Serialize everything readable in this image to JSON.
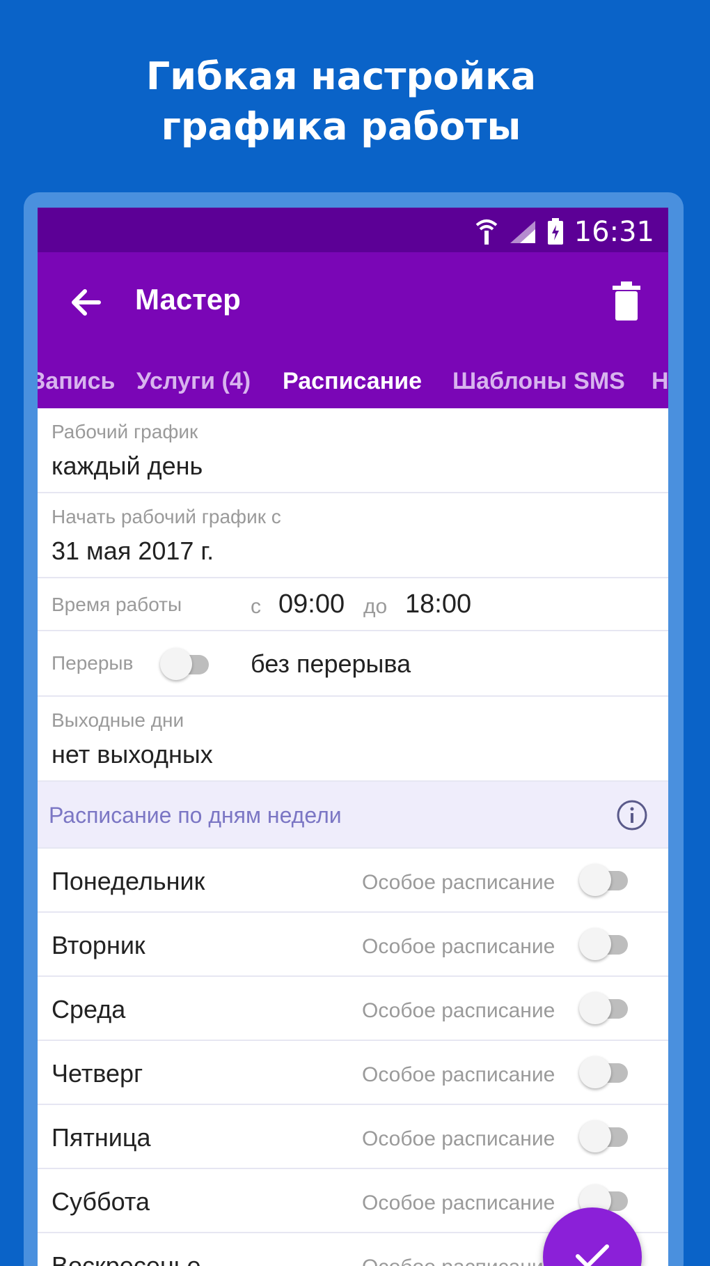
{
  "promo": {
    "title_line1": "Гибкая настройка",
    "title_line2": "графика работы"
  },
  "status_bar": {
    "time": "16:31",
    "icons": [
      "wifi-icon",
      "signal-icon",
      "battery-icon"
    ]
  },
  "toolbar": {
    "title": "Мастер",
    "back_icon": "arrow-left-icon",
    "delete_icon": "trash-icon"
  },
  "tabs": [
    {
      "label": "Запись"
    },
    {
      "label": "Услуги (4)"
    },
    {
      "label": "Расписание",
      "active": true
    },
    {
      "label": "Шаблоны SMS"
    },
    {
      "label": "Н"
    }
  ],
  "work_schedule": {
    "label": "Рабочий график",
    "value": "каждый день"
  },
  "start_schedule": {
    "label": "Начать рабочий график с",
    "value": "31 мая 2017 г."
  },
  "work_time": {
    "label": "Время работы",
    "from_label": "с",
    "from_value": "09:00",
    "to_label": "до",
    "to_value": "18:00"
  },
  "break": {
    "label": "Перерыв",
    "enabled": false,
    "value": "без перерыва"
  },
  "days_off": {
    "label": "Выходные дни",
    "value": "нет выходных"
  },
  "weekday_section": {
    "title": "Расписание по дням недели",
    "icon": "info-icon"
  },
  "weekdays": [
    {
      "name": "Понедельник",
      "special_label": "Особое расписание",
      "enabled": false
    },
    {
      "name": "Вторник",
      "special_label": "Особое расписание",
      "enabled": false
    },
    {
      "name": "Среда",
      "special_label": "Особое расписание",
      "enabled": false
    },
    {
      "name": "Четверг",
      "special_label": "Особое расписание",
      "enabled": false
    },
    {
      "name": "Пятница",
      "special_label": "Особое расписание",
      "enabled": false
    },
    {
      "name": "Суббота",
      "special_label": "Особое расписание",
      "enabled": false
    },
    {
      "name": "Воскресенье",
      "special_label": "Особое расписание",
      "enabled": false
    }
  ],
  "fab": {
    "icon": "check-icon"
  },
  "colors": {
    "background": "#0a63c8",
    "status_bar": "#5c0096",
    "toolbar": "#7a06b6",
    "section_header": "#efedfb",
    "section_title": "#7b76c4",
    "fab": "#8b20d8"
  }
}
